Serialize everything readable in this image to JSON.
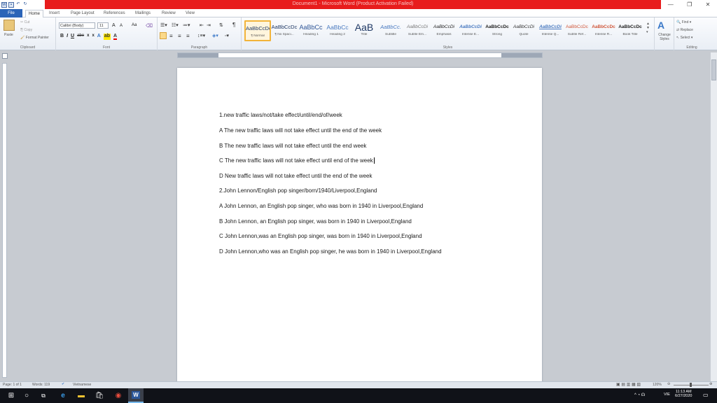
{
  "window": {
    "title": "Document1 - Microsoft Word (Product Activation Failed)",
    "minimize_icon": "minimize-icon",
    "restore_icon": "restore-icon",
    "close_icon": "close-icon"
  },
  "tabs": [
    "File",
    "Home",
    "Insert",
    "Page Layout",
    "References",
    "Mailings",
    "Review",
    "View"
  ],
  "clipboard": {
    "paste": "Paste",
    "cut": "Cut",
    "copy": "Copy",
    "format_painter": "Format Painter",
    "label": "Clipboard"
  },
  "font": {
    "name": "Calibri (Body)",
    "size": "11",
    "label": "Font",
    "grow": "A",
    "shrink": "A",
    "case": "Aa",
    "bold": "B",
    "italic": "I",
    "underline": "U",
    "strike": "abe",
    "sub": "x",
    "sup": "x",
    "color_a": "A"
  },
  "paragraph": {
    "label": "Paragraph",
    "pilcrow": "¶"
  },
  "styles": {
    "label": "Styles",
    "items": [
      {
        "preview": "AaBbCcDc",
        "name": "¶ Normal"
      },
      {
        "preview": "AaBbCcDc",
        "name": "¶ No Spaci..."
      },
      {
        "preview": "AaBbCc",
        "name": "Heading 1"
      },
      {
        "preview": "AaBbCc",
        "name": "Heading 2"
      },
      {
        "preview": "AaB",
        "name": "Title"
      },
      {
        "preview": "AaBbCc.",
        "name": "Subtitle"
      },
      {
        "preview": "AaBbCcDi",
        "name": "Subtle Em..."
      },
      {
        "preview": "AaBbCcDi",
        "name": "Emphasis"
      },
      {
        "preview": "AaBbCcDi",
        "name": "Intense E..."
      },
      {
        "preview": "AaBbCcDc",
        "name": "Strong"
      },
      {
        "preview": "AaBbCcDi",
        "name": "Quote"
      },
      {
        "preview": "AaBbCcDi",
        "name": "Intense Q..."
      },
      {
        "preview": "AaBbCcDc",
        "name": "Subtle Ref..."
      },
      {
        "preview": "AaBbCcDc",
        "name": "Intense R..."
      },
      {
        "preview": "AaBbCcDc",
        "name": "Book Title"
      }
    ],
    "change_styles": "Change Styles"
  },
  "editing": {
    "find": "Find",
    "replace": "Replace",
    "select": "Select",
    "label": "Editing"
  },
  "document": {
    "lines": [
      "1.new traffic laws/not/take effect/until/end/of/week",
      "A The new traffic laws will not take effect until the end of the week",
      "B The new traffic laws will not take effect until the end week",
      "C The new traffic laws will not take effect until end of the week",
      "D New traffic laws will not take effect until the end of the week",
      "2.John Lennon/English pop singer/born/1940/Liverpool,England",
      "A John Lennon, an English pop singer, who was born in 1940 in Liverpool,England",
      "B John Lennon, an English pop singer,  was born in 1940 in Liverpool,England",
      "C John Lennon,was an English pop singer, was born in 1940 in Liverpool,England",
      "D John Lennon,who was an English pop singer, he was born in 1940 in Liverpool,England"
    ],
    "caret_line": 3
  },
  "status": {
    "page": "Page: 1 of 1",
    "words": "Words: 119",
    "language": "Vietnamese",
    "zoom": "120%"
  },
  "taskbar": {
    "lang": "VIE",
    "time": "11:13 AM",
    "date": "6/27/2020"
  },
  "colors": {
    "title_bar": "#e81c1c",
    "file_tab": "#2b64b8",
    "accent": "#2b579a"
  }
}
